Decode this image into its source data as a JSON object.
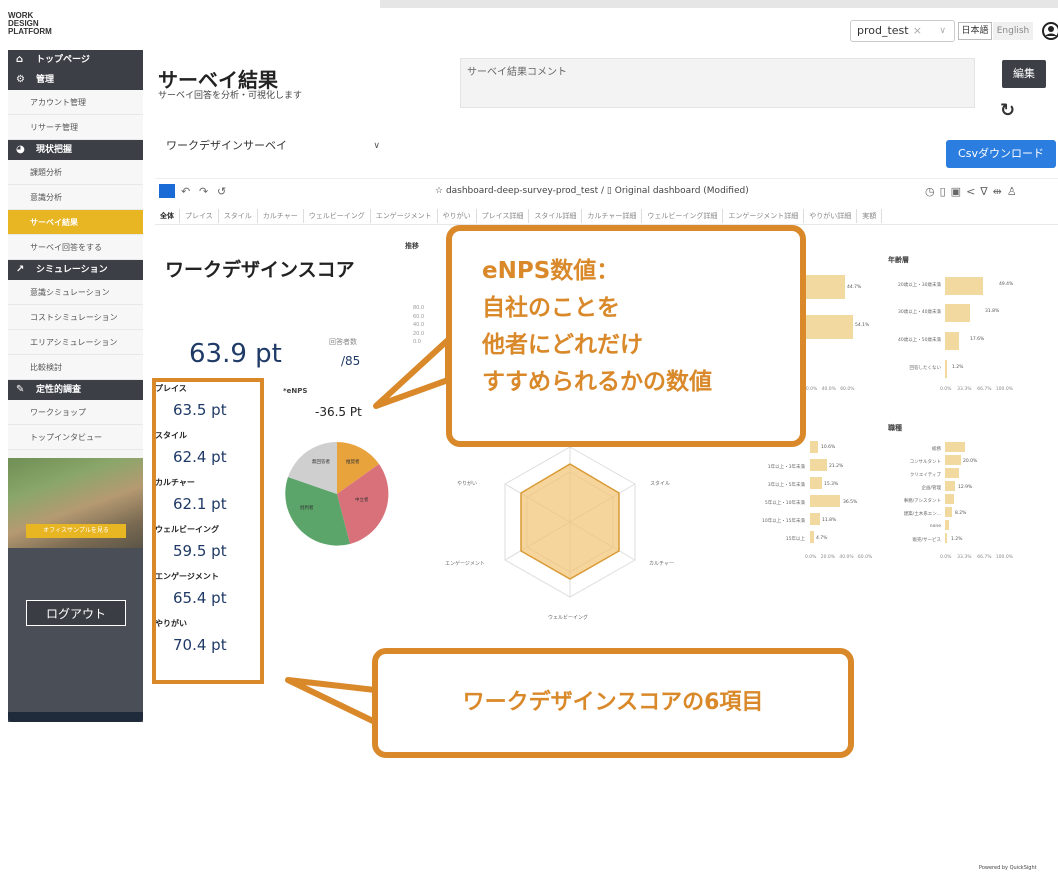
{
  "header": {
    "logo_lines": [
      "WORK",
      "DESIGN",
      "PLATFORM"
    ],
    "project_select": "prod_test",
    "lang_ja": "日本語",
    "lang_en": "English"
  },
  "sidebar": {
    "sections": [
      {
        "label": "トップページ",
        "icon": "home-icon"
      },
      {
        "label": "管理",
        "icon": "admin-icon",
        "items": [
          "アカウント管理",
          "リサーチ管理"
        ]
      },
      {
        "label": "現状把握",
        "icon": "pie-chart-icon",
        "items": [
          "課題分析",
          "意識分析",
          "サーベイ結果",
          "サーベイ回答をする"
        ]
      },
      {
        "label": "シミュレーション",
        "icon": "line-chart-icon",
        "items": [
          "意識シミュレーション",
          "コストシミュレーション",
          "エリアシミュレーション",
          "比較検討"
        ]
      },
      {
        "label": "定性的調査",
        "icon": "pen-icon",
        "items": [
          "ワークショップ",
          "トップインタビュー"
        ]
      }
    ],
    "active_item": "サーベイ結果",
    "photo_button": "オフィスサンプルを見る",
    "logout": "ログアウト"
  },
  "page": {
    "title": "サーベイ結果",
    "subtitle": "サーベイ回答を分析・可視化します",
    "comment_placeholder": "サーベイ結果コメント",
    "edit_button": "編集",
    "survey_select": "ワークデザインサーベイ",
    "csv_button": "Csvダウンロード"
  },
  "dashboard": {
    "title_path": "dashboard-deep-survey-prod_test /",
    "title_name": "Original dashboard (Modified)",
    "tabs": [
      "全体",
      "プレイス",
      "スタイル",
      "カルチャー",
      "ウェルビーイング",
      "エンゲージメント",
      "やりがい",
      "プレイス詳細",
      "スタイル詳細",
      "カルチャー詳細",
      "ウェルビーイング詳細",
      "エンゲージメント詳細",
      "やりがい詳細",
      "実額"
    ],
    "score_title": "ワークデザインスコア",
    "total_score": "63.9 pt",
    "responses_label": "回答者数",
    "responses_value": "/85",
    "enps_label": "*eNPS",
    "enps_value": "-36.5 Pt",
    "trend_label": "推移",
    "trend_y_ticks": [
      "80.0",
      "60.0",
      "40.0",
      "20.0",
      "0.0"
    ],
    "items": [
      {
        "label": "プレイス",
        "value": "63.5 pt"
      },
      {
        "label": "スタイル",
        "value": "62.4 pt"
      },
      {
        "label": "カルチャー",
        "value": "62.1 pt"
      },
      {
        "label": "ウェルビーイング",
        "value": "59.5 pt"
      },
      {
        "label": "エンゲージメント",
        "value": "65.4 pt"
      },
      {
        "label": "やりがい",
        "value": "70.4 pt"
      }
    ],
    "pie_labels": [
      "推奨者",
      "中立者",
      "批判者",
      "無回答者"
    ],
    "radar_labels": [
      "やりがい",
      "スタイル",
      "カルチャー",
      "ウェルビーイング",
      "エンゲージメント"
    ],
    "age_chart": {
      "title": "年齢層",
      "rows": [
        {
          "label": "20歳以上・30歳未満",
          "value": "49.4%"
        },
        {
          "label": "30歳以上・40歳未満",
          "value": "31.8%"
        },
        {
          "label": "40歳以上・50歳未満",
          "value": "17.6%"
        },
        {
          "label": "回答したくない",
          "value": "1.2%"
        }
      ],
      "axis": [
        "0.0%",
        "33.3%",
        "66.7%",
        "100.0%"
      ]
    },
    "job_chart": {
      "title": "職種",
      "rows": [
        {
          "label": "総務",
          "value": ""
        },
        {
          "label": "コンサルタント",
          "value": "20.0%"
        },
        {
          "label": "クリエイティブ",
          "value": ""
        },
        {
          "label": "企画/管理",
          "value": "12.9%"
        },
        {
          "label": "事務/アシスタント",
          "value": ""
        },
        {
          "label": "建築/土木系エン...",
          "value": "8.2%"
        },
        {
          "label": "none",
          "value": ""
        },
        {
          "label": "販売/サービス",
          "value": "1.2%"
        }
      ],
      "axis": [
        "0.0%",
        "33.3%",
        "66.7%",
        "100.0%"
      ]
    },
    "tenure_chart": {
      "rows": [
        {
          "label": "",
          "value": "10.6%"
        },
        {
          "label": "1年以上・3年未満",
          "value": "21.2%"
        },
        {
          "label": "3年以上・5年未満",
          "value": "15.3%"
        },
        {
          "label": "5年以上・10年未満",
          "value": "36.5%"
        },
        {
          "label": "10年以上・15年未満",
          "value": "11.8%"
        },
        {
          "label": "15年以上",
          "value": "4.7%"
        }
      ],
      "axis": [
        "0.0%",
        "20.0%",
        "40.0%",
        "60.0%"
      ]
    },
    "upper_bars": {
      "values": [
        "44.7%",
        "54.1%"
      ],
      "axis": [
        "20.0%",
        "40.0%",
        "60.0%"
      ]
    },
    "powered_by": "Powered by QuickSight"
  },
  "callouts": {
    "enps_lines": [
      "eNPS数値：",
      "自社のことを",
      "他者にどれだけ",
      "すすめられるかの数値"
    ],
    "items_text": "ワークデザインスコアの6項目"
  },
  "colors": {
    "accent": "#d9892a",
    "sidebar_active": "#e8b523",
    "csv_button": "#2b7de0",
    "bar_fill": "#f2d9a0"
  }
}
